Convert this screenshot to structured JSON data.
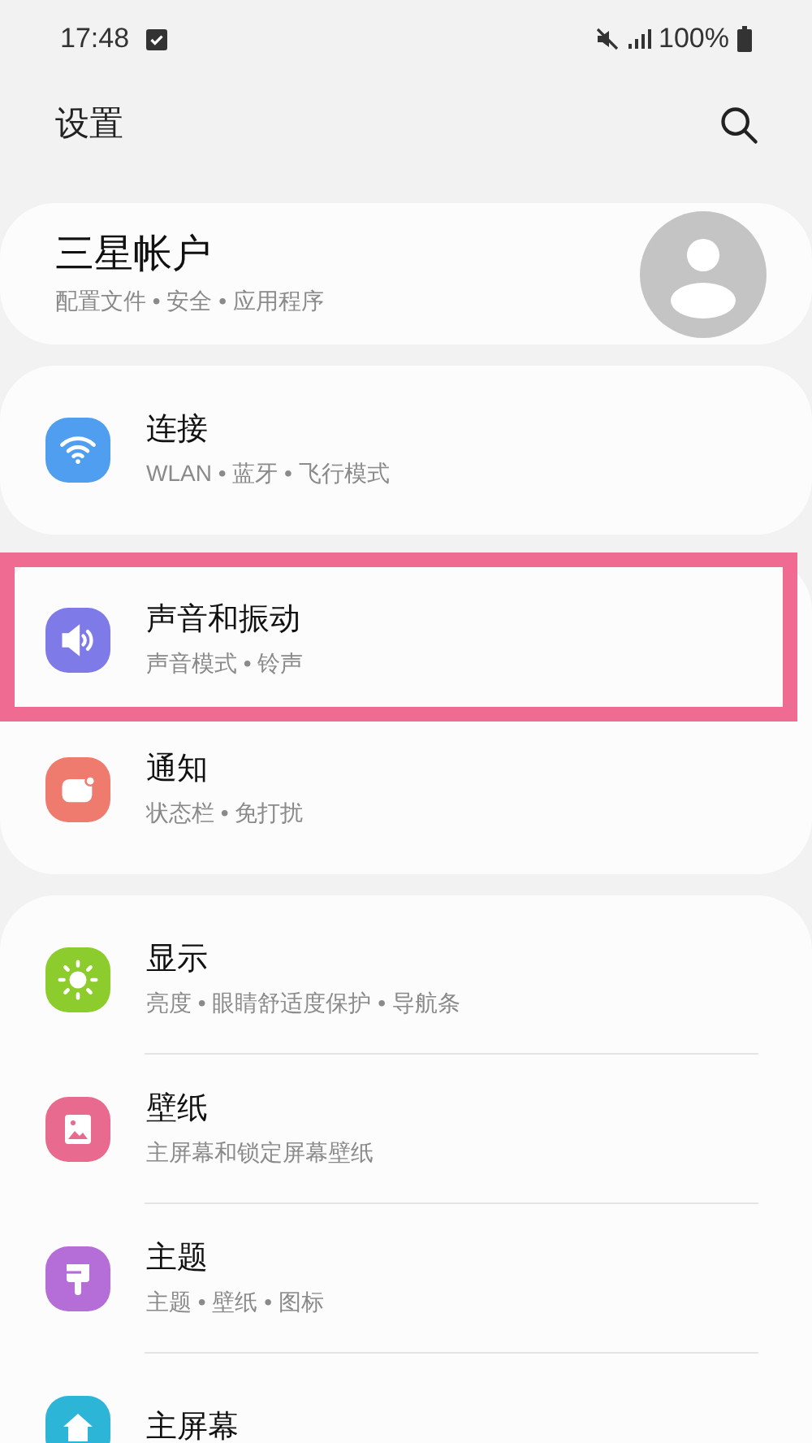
{
  "status_bar": {
    "time": "17:48",
    "battery": "100%"
  },
  "header": {
    "title": "设置"
  },
  "account": {
    "title": "三星帐户",
    "subtitle": "配置文件 • 安全 • 应用程序"
  },
  "groups": [
    {
      "items": [
        {
          "kind": "wifi",
          "color": "#4f9ef0",
          "title": "连接",
          "subtitle": "WLAN • 蓝牙 • 飞行模式",
          "highlighted": false
        }
      ]
    },
    {
      "items": [
        {
          "kind": "sound",
          "color": "#7e7ae8",
          "title": "声音和振动",
          "subtitle": "声音模式 • 铃声",
          "highlighted": true
        },
        {
          "kind": "notification",
          "color": "#ee7b6d",
          "title": "通知",
          "subtitle": "状态栏 • 免打扰",
          "highlighted": false
        }
      ]
    },
    {
      "items": [
        {
          "kind": "display",
          "color": "#8ccc2c",
          "title": "显示",
          "subtitle": "亮度 • 眼睛舒适度保护 • 导航条",
          "highlighted": false
        },
        {
          "kind": "wallpaper",
          "color": "#e96a8f",
          "title": "壁纸",
          "subtitle": "主屏幕和锁定屏幕壁纸",
          "highlighted": false
        },
        {
          "kind": "theme",
          "color": "#b56ed8",
          "title": "主题",
          "subtitle": "主题 • 壁纸 • 图标",
          "highlighted": false
        },
        {
          "kind": "home",
          "color": "#2cb5d6",
          "title": "主屏幕",
          "highlighted": false
        }
      ]
    }
  ]
}
